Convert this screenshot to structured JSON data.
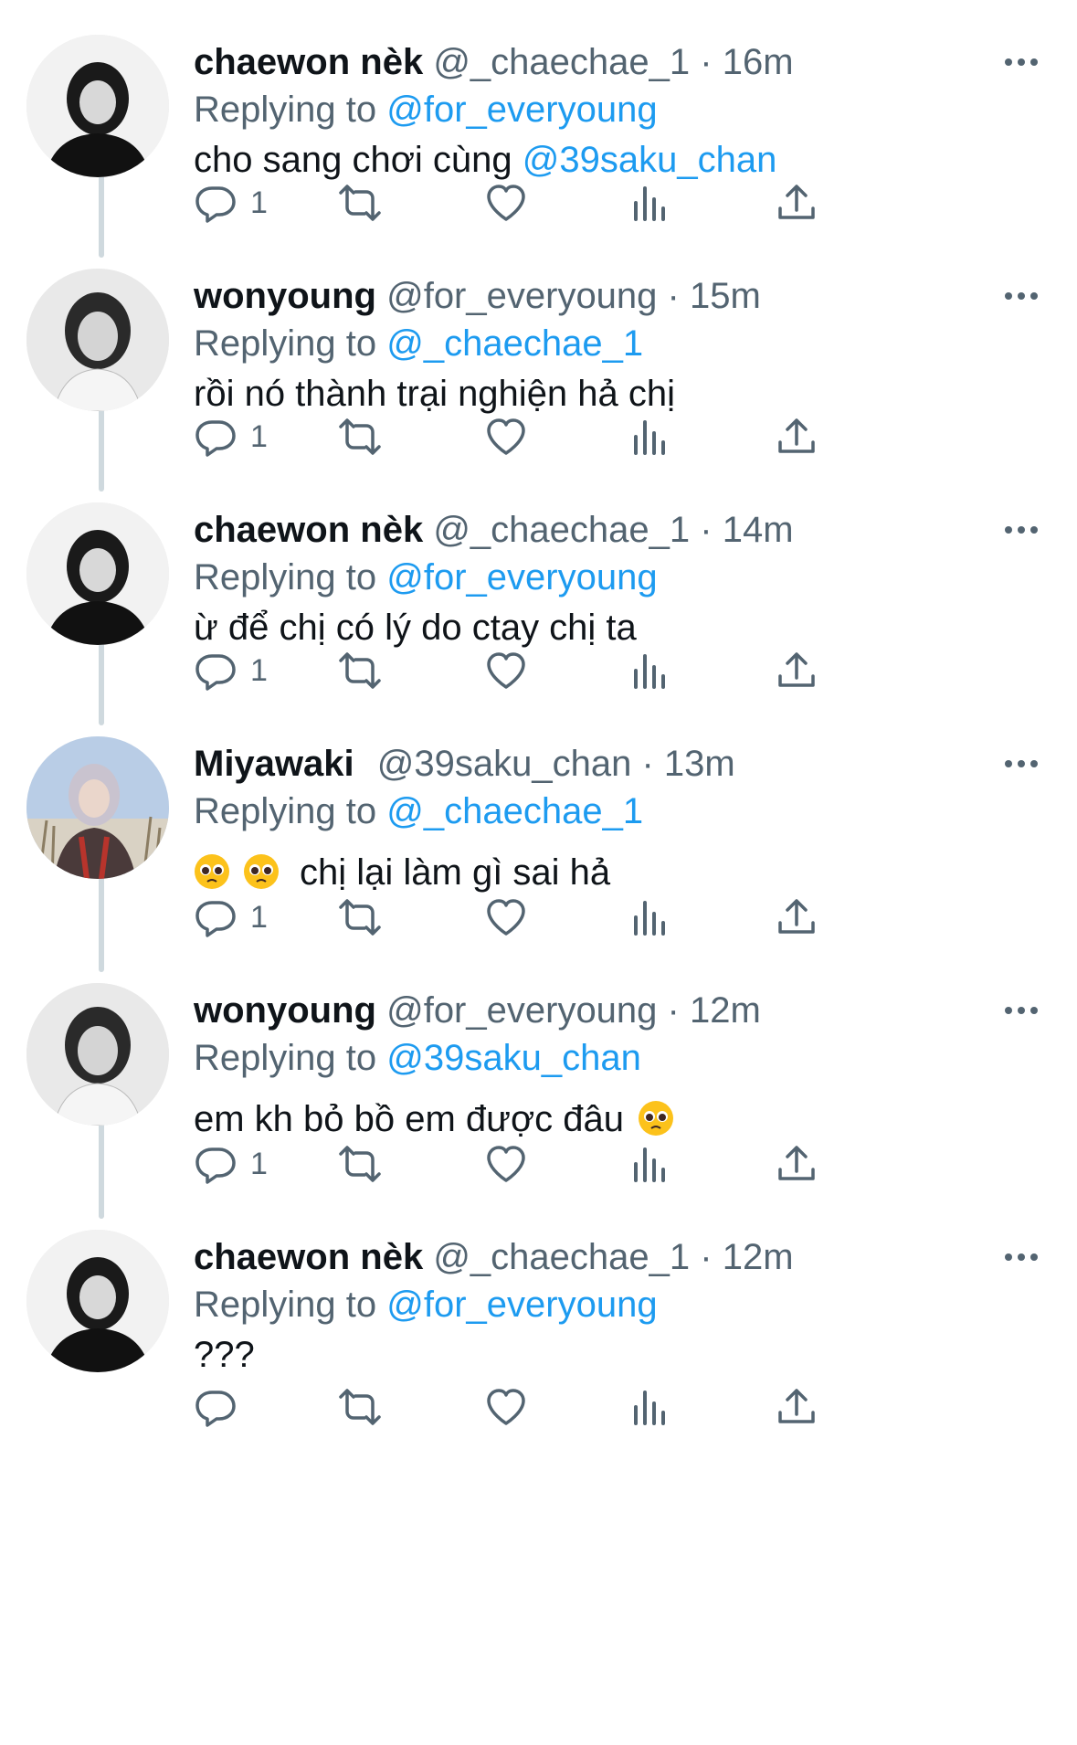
{
  "tweets": [
    {
      "name": "chaewon nèk",
      "handle": "@_chaechae_1",
      "time": "16m",
      "replying_label": "Replying to",
      "replying_to": "@for_everyoung",
      "text": "cho sang chơi cùng ",
      "text_mention": "@39saku_chan",
      "reply_count": "1"
    },
    {
      "name": "wonyoung",
      "handle": "@for_everyoung",
      "time": "15m",
      "replying_label": "Replying to",
      "replying_to": "@_chaechae_1",
      "text": "rồi nó thành trại nghiện hả chị",
      "reply_count": "1"
    },
    {
      "name": "chaewon nèk",
      "handle": "@_chaechae_1",
      "time": "14m",
      "replying_label": "Replying to",
      "replying_to": "@for_everyoung",
      "text": "ừ để chị có lý do ctay chị ta",
      "reply_count": "1"
    },
    {
      "name": "Miyawaki",
      "handle": "@39saku_chan",
      "time": "13m",
      "replying_label": "Replying to",
      "replying_to": "@_chaechae_1",
      "text": "chị lại làm gì sai hả",
      "reply_count": "1"
    },
    {
      "name": "wonyoung",
      "handle": "@for_everyoung",
      "time": "12m",
      "replying_label": "Replying to",
      "replying_to": "@39saku_chan",
      "text": "em kh bỏ bồ em được đâu",
      "reply_count": "1"
    },
    {
      "name": "chaewon nèk",
      "handle": "@_chaechae_1",
      "time": "12m",
      "replying_label": "Replying to",
      "replying_to": "@for_everyoung",
      "text": "???",
      "reply_count": ""
    }
  ],
  "separator": " · ",
  "icons": {
    "reply": "reply-icon",
    "retweet": "retweet-icon",
    "like": "heart-icon",
    "views": "views-icon",
    "share": "share-icon",
    "more": "more-icon",
    "emoji": "pleading-face-emoji"
  },
  "colors": {
    "text": "#0f1419",
    "secondary": "#536471",
    "link": "#1d9bf0",
    "thread_line": "#cfd9de"
  }
}
